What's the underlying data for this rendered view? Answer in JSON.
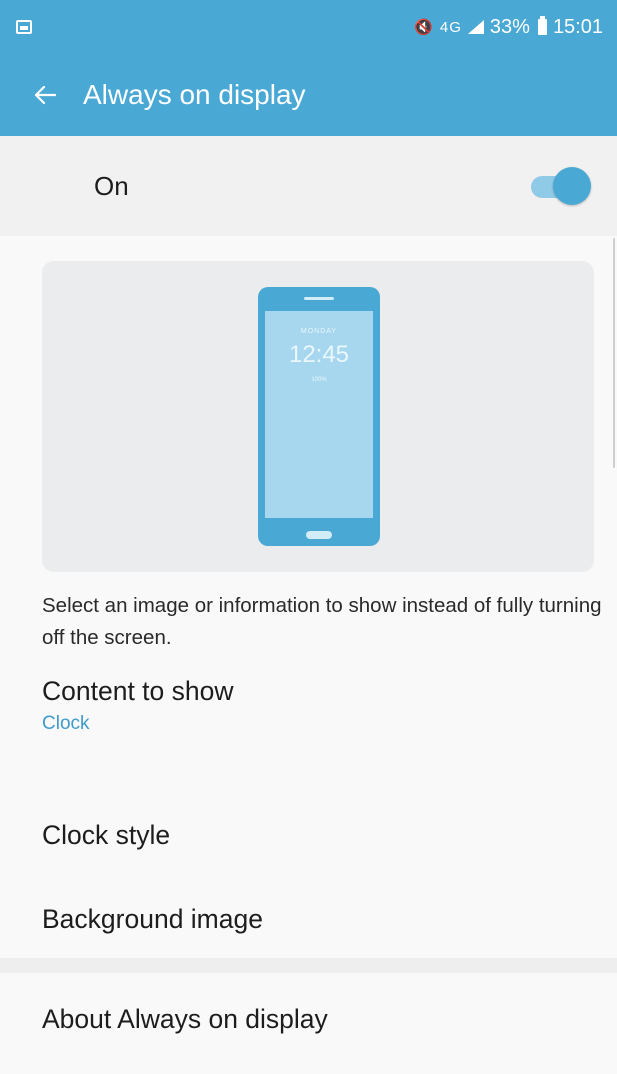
{
  "status_bar": {
    "mute_label": "🔇",
    "network_label": "4G",
    "battery_percent": "33%",
    "time": "15:01"
  },
  "app_bar": {
    "title": "Always on display"
  },
  "master_switch": {
    "label": "On",
    "checked": true
  },
  "preview": {
    "phone_date": "MONDAY",
    "phone_time": "12:45",
    "phone_battery": "100%"
  },
  "description": "Select an image or information to show instead of fully turning off the screen.",
  "settings": {
    "content_to_show": {
      "title": "Content to show",
      "value": "Clock"
    },
    "clock_style": {
      "title": "Clock style"
    },
    "background_image": {
      "title": "Background image"
    },
    "about": {
      "title": "About Always on display"
    }
  },
  "colors": {
    "accent": "#4aa8d4",
    "accent_text": "#3f9bcb"
  },
  "icons": {
    "back": "arrow-left-icon",
    "gallery": "image-icon",
    "mute": "mute-icon",
    "signal": "signal-icon",
    "battery": "battery-icon"
  }
}
